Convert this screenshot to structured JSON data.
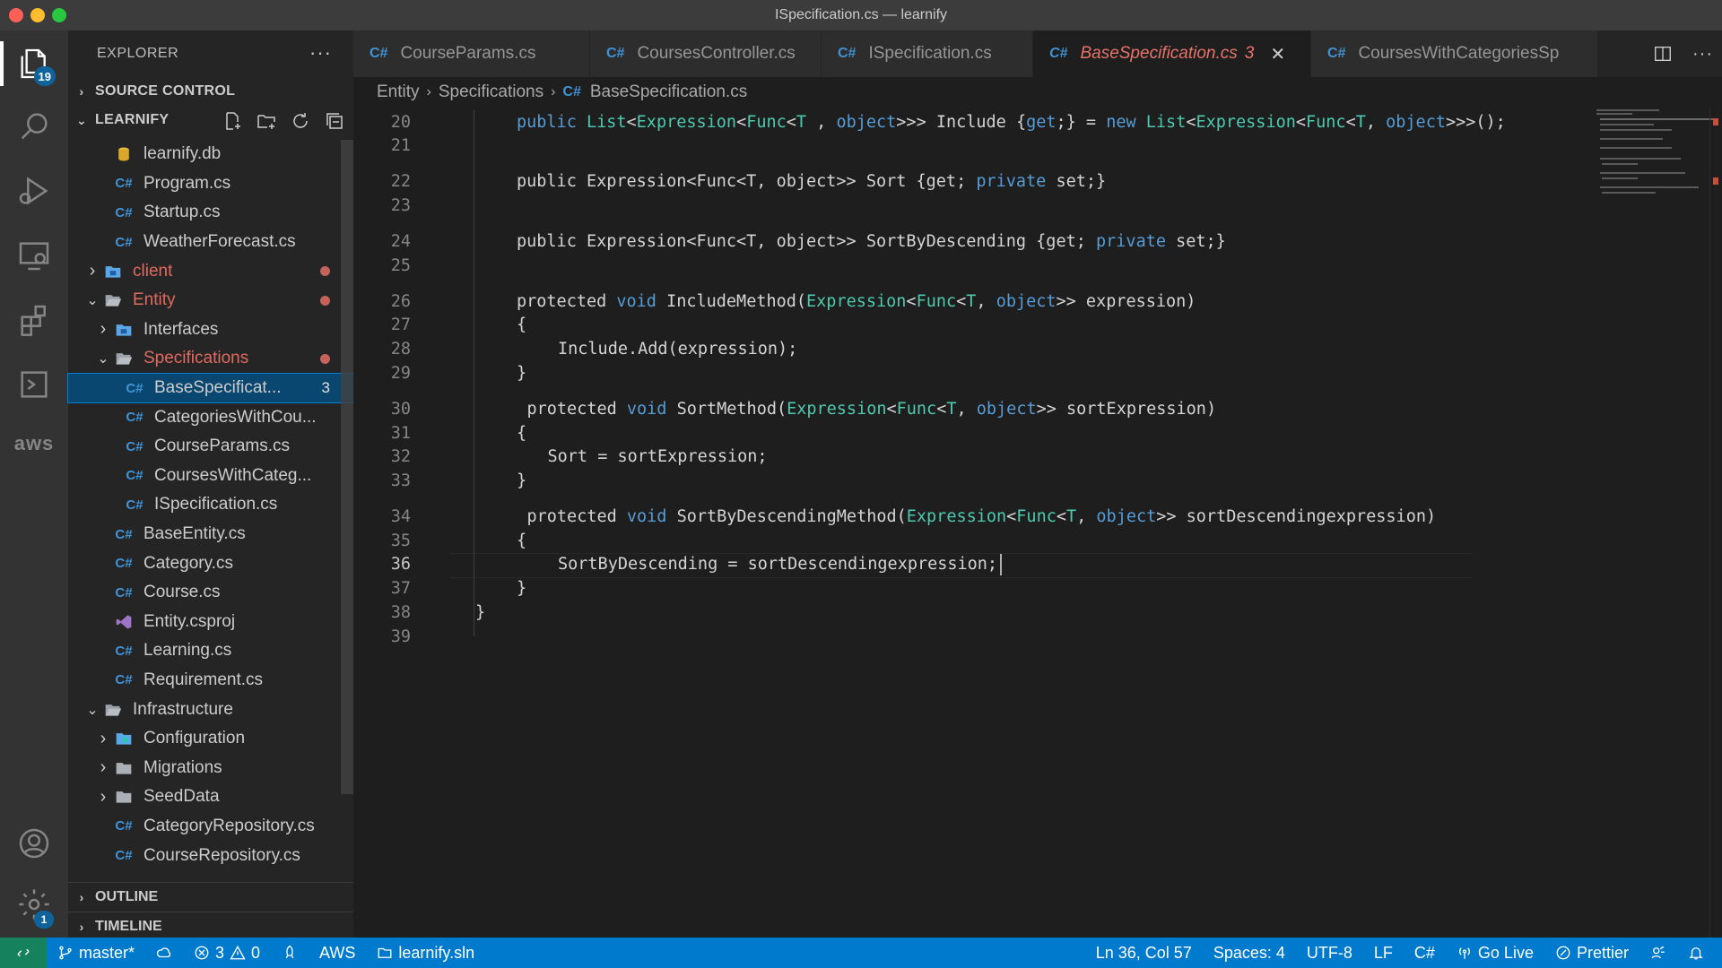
{
  "window": {
    "title": "ISpecification.cs — learnify"
  },
  "activity": {
    "explorer_badge": "19",
    "aws_label": "aws",
    "settings_badge": "1"
  },
  "sidebar": {
    "title": "EXPLORER",
    "more": "···",
    "source_control": "SOURCE CONTROL",
    "project": "LEARNIFY",
    "outline": "OUTLINE",
    "timeline": "TIMELINE",
    "items": [
      {
        "label": "learnify.db",
        "icon": "database-icon",
        "indent": 2
      },
      {
        "label": "Program.cs",
        "icon": "csharp-icon",
        "indent": 2
      },
      {
        "label": "Startup.cs",
        "icon": "csharp-icon",
        "indent": 2
      },
      {
        "label": "WeatherForecast.cs",
        "icon": "csharp-icon",
        "indent": 2
      },
      {
        "label": "client",
        "icon": "folder-blue-icon",
        "indent": 1,
        "chevron": "right",
        "modified": true
      },
      {
        "label": "Entity",
        "icon": "folder-open-icon",
        "indent": 1,
        "chevron": "down",
        "modified": true
      },
      {
        "label": "Interfaces",
        "icon": "folder-blue-icon",
        "indent": 2,
        "chevron": "right"
      },
      {
        "label": "Specifications",
        "icon": "folder-open-icon",
        "indent": 2,
        "chevron": "down",
        "modified": true
      },
      {
        "label": "BaseSpecificat...",
        "icon": "csharp-icon",
        "indent": 3,
        "selected": true,
        "count": "3"
      },
      {
        "label": "CategoriesWithCou...",
        "icon": "csharp-icon",
        "indent": 3
      },
      {
        "label": "CourseParams.cs",
        "icon": "csharp-icon",
        "indent": 3
      },
      {
        "label": "CoursesWithCateg...",
        "icon": "csharp-icon",
        "indent": 3
      },
      {
        "label": "ISpecification.cs",
        "icon": "csharp-icon",
        "indent": 3
      },
      {
        "label": "BaseEntity.cs",
        "icon": "csharp-icon",
        "indent": 2
      },
      {
        "label": "Category.cs",
        "icon": "csharp-icon",
        "indent": 2
      },
      {
        "label": "Course.cs",
        "icon": "csharp-icon",
        "indent": 2
      },
      {
        "label": "Entity.csproj",
        "icon": "csproj-icon",
        "indent": 2
      },
      {
        "label": "Learning.cs",
        "icon": "csharp-icon",
        "indent": 2
      },
      {
        "label": "Requirement.cs",
        "icon": "csharp-icon",
        "indent": 2
      },
      {
        "label": "Infrastructure",
        "icon": "folder-open-icon",
        "indent": 1,
        "chevron": "down"
      },
      {
        "label": "Configuration",
        "icon": "folder-config-icon",
        "indent": 2,
        "chevron": "right"
      },
      {
        "label": "Migrations",
        "icon": "folder-icon",
        "indent": 2,
        "chevron": "right"
      },
      {
        "label": "SeedData",
        "icon": "folder-icon",
        "indent": 2,
        "chevron": "right"
      },
      {
        "label": "CategoryRepository.cs",
        "icon": "csharp-icon",
        "indent": 2
      },
      {
        "label": "CourseRepository.cs",
        "icon": "csharp-icon",
        "indent": 2
      }
    ]
  },
  "tabs": [
    {
      "label": "CourseParams.cs",
      "tag": "C#"
    },
    {
      "label": "CoursesController.cs",
      "tag": "C#"
    },
    {
      "label": "ISpecification.cs",
      "tag": "C#"
    },
    {
      "label": "BaseSpecification.cs",
      "tag": "C#",
      "active": true,
      "errors": "3",
      "close": "✕"
    },
    {
      "label": "CoursesWithCategoriesSp",
      "tag": "C#"
    }
  ],
  "tab_actions": {
    "more": "···"
  },
  "breadcrumb": {
    "part1": "Entity",
    "part2": "Specifications",
    "tag": "C#",
    "part3": "BaseSpecification.cs"
  },
  "editor": {
    "lines": [
      {
        "n": "20",
        "y": 0,
        "indent": 1,
        "tokens": [
          [
            "kw",
            "public "
          ],
          [
            "ty",
            "List"
          ],
          [
            "",
            "<"
          ],
          [
            "ty",
            "Expression"
          ],
          [
            "",
            "<"
          ],
          [
            "ty",
            "Func"
          ],
          [
            "",
            "<"
          ],
          [
            "ty",
            "T"
          ],
          [
            "",
            " , "
          ],
          [
            "kw",
            "object"
          ],
          [
            "",
            ">>> Include {"
          ],
          [
            "kw",
            "get"
          ],
          [
            "",
            ";} = "
          ],
          [
            "kw",
            "new "
          ],
          [
            "ty",
            "List"
          ],
          [
            "",
            "<"
          ],
          [
            "ty",
            "Expression"
          ],
          [
            "",
            "<"
          ],
          [
            "ty",
            "Func"
          ],
          [
            "",
            "<"
          ],
          [
            "ty",
            "T"
          ],
          [
            "",
            ", "
          ],
          [
            "kw",
            "object"
          ],
          [
            "",
            ">>>();"
          ]
        ]
      },
      {
        "n": "21",
        "y": 1,
        "tokens": []
      },
      {
        "n": "22",
        "y": 2.5,
        "indent": 1,
        "tokens": [
          [
            "",
            "public Expression<Func<T, object>> Sort {get; "
          ],
          [
            "kw",
            "private"
          ],
          [
            "",
            " set;}"
          ]
        ]
      },
      {
        "n": "23",
        "y": 3.5,
        "tokens": []
      },
      {
        "n": "24",
        "y": 5,
        "indent": 1,
        "tokens": [
          [
            "",
            "public Expression<Func<T, object>> SortByDescending {get; "
          ],
          [
            "kw",
            "private"
          ],
          [
            "",
            " set;}"
          ]
        ]
      },
      {
        "n": "25",
        "y": 6,
        "tokens": []
      },
      {
        "n": "26",
        "y": 7.5,
        "indent": 1,
        "tokens": [
          [
            "",
            "protected "
          ],
          [
            "kw",
            "void"
          ],
          [
            "",
            " IncludeMethod("
          ],
          [
            "ty",
            "Expression"
          ],
          [
            "",
            "<"
          ],
          [
            "ty",
            "Func"
          ],
          [
            "",
            "<"
          ],
          [
            "ty",
            "T"
          ],
          [
            "",
            ", "
          ],
          [
            "kw",
            "object"
          ],
          [
            "",
            ">> expression)"
          ]
        ]
      },
      {
        "n": "27",
        "y": 8.5,
        "indent": 1,
        "tokens": [
          [
            "",
            "{"
          ]
        ]
      },
      {
        "n": "28",
        "y": 9.5,
        "indent": 2,
        "tokens": [
          [
            "",
            "Include.Add(expression);"
          ]
        ]
      },
      {
        "n": "29",
        "y": 10.5,
        "indent": 1,
        "tokens": [
          [
            "",
            "}"
          ]
        ]
      },
      {
        "n": "30",
        "y": 12,
        "indent": 1.25,
        "tokens": [
          [
            "",
            "protected "
          ],
          [
            "kw",
            "void"
          ],
          [
            "",
            " SortMethod("
          ],
          [
            "ty",
            "Expression"
          ],
          [
            "",
            "<"
          ],
          [
            "ty",
            "Func"
          ],
          [
            "",
            "<"
          ],
          [
            "ty",
            "T"
          ],
          [
            "",
            ", "
          ],
          [
            "kw",
            "object"
          ],
          [
            "",
            ">> sortExpression)"
          ]
        ]
      },
      {
        "n": "31",
        "y": 13,
        "indent": 1,
        "tokens": [
          [
            "",
            "{"
          ]
        ]
      },
      {
        "n": "32",
        "y": 14,
        "indent": 1.75,
        "tokens": [
          [
            "",
            "Sort = sortExpression;"
          ]
        ]
      },
      {
        "n": "33",
        "y": 15,
        "indent": 1,
        "tokens": [
          [
            "",
            "}"
          ]
        ]
      },
      {
        "n": "34",
        "y": 16.5,
        "indent": 1.25,
        "tokens": [
          [
            "",
            "protected "
          ],
          [
            "kw",
            "void"
          ],
          [
            "",
            " SortByDescendingMethod("
          ],
          [
            "ty",
            "Expression"
          ],
          [
            "",
            "<"
          ],
          [
            "ty",
            "Func"
          ],
          [
            "",
            "<"
          ],
          [
            "ty",
            "T"
          ],
          [
            "",
            ", "
          ],
          [
            "kw",
            "object"
          ],
          [
            "",
            ">> sortDescendingexpression)"
          ]
        ]
      },
      {
        "n": "35",
        "y": 17.5,
        "indent": 1,
        "tokens": [
          [
            "",
            "{"
          ]
        ]
      },
      {
        "n": "36",
        "y": 18.5,
        "indent": 2,
        "current": true,
        "tokens": [
          [
            "",
            "SortByDescending = sortDescendingexpression;"
          ]
        ]
      },
      {
        "n": "37",
        "y": 19.5,
        "indent": 1,
        "tokens": [
          [
            "",
            "}"
          ]
        ]
      },
      {
        "n": "38",
        "y": 20.5,
        "indent": 0,
        "tokens": [
          [
            "",
            "}"
          ]
        ]
      },
      {
        "n": "39",
        "y": 21.5,
        "tokens": []
      }
    ]
  },
  "status": {
    "branch": "master*",
    "errors": "3",
    "warnings": "0",
    "aws": "AWS",
    "solution": "learnify.sln",
    "position": "Ln 36, Col 57",
    "spaces": "Spaces: 4",
    "encoding": "UTF-8",
    "eol": "LF",
    "language": "C#",
    "golive": "Go Live",
    "prettier": "Prettier"
  },
  "colors": {
    "accent": "#007acc",
    "selection": "#094771",
    "modified": "#e06a5f",
    "keyword": "#569cd6",
    "type": "#4ec9b0"
  }
}
